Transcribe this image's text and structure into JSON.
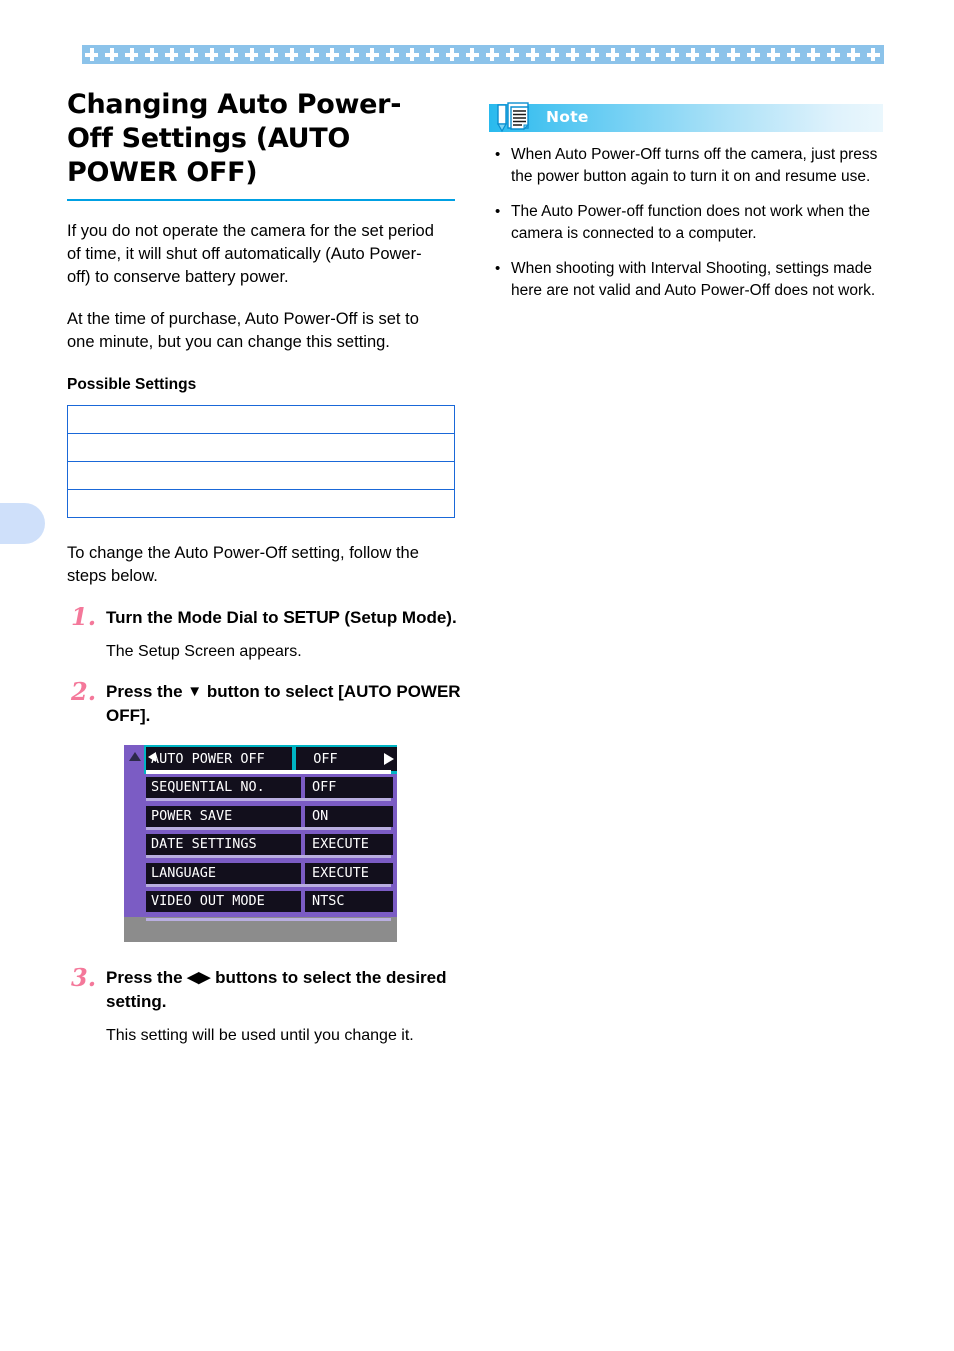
{
  "page": {
    "title": "Changing Auto Power-Off Settings (AUTO POWER OFF)",
    "accent_color": "#00a0e3",
    "step_number_color": "#f4789a",
    "table_border_color": "#1a68d8",
    "band_color": "#8cc3ea"
  },
  "intro": {
    "paragraph1": "If you do not operate the camera for the set period of time, it will shut off automatically (Auto Power-off) to conserve battery power.",
    "paragraph2": "At the time of purchase, Auto Power-Off is set to one minute, but you can change this setting."
  },
  "possible_settings": {
    "heading": "Possible Settings",
    "rows": [
      "",
      "",
      "",
      ""
    ]
  },
  "steps_intro": "To change the Auto Power-Off setting, follow the steps below.",
  "steps": [
    {
      "number": "1.",
      "head_before": "Turn the Mode Dial to ",
      "head_emphasis": "SETUP",
      "head_after": " (Setup Mode).",
      "body": "The Setup Screen appears."
    },
    {
      "number": "2.",
      "head_before": "Press the ",
      "head_glyph": "▼",
      "head_after": " button to select [AUTO POWER OFF].",
      "body": ""
    },
    {
      "number": "3.",
      "head_before": "Press the ",
      "head_glyph": "◀▶",
      "head_after": " buttons to select the desired setting.",
      "body": "This setting will be used until you change it."
    }
  ],
  "lcd": {
    "up_arrow": "▲",
    "left_arrow": "◀",
    "right_arrow": "▶",
    "selected_index": 0,
    "rows": [
      {
        "label": "AUTO POWER OFF",
        "value": "OFF"
      },
      {
        "label": "SEQUENTIAL NO.",
        "value": "OFF"
      },
      {
        "label": "POWER SAVE",
        "value": "ON"
      },
      {
        "label": "DATE SETTINGS",
        "value": "EXECUTE"
      },
      {
        "label": "LANGUAGE",
        "value": "EXECUTE"
      },
      {
        "label": "VIDEO OUT MODE",
        "value": "NTSC"
      }
    ]
  },
  "note": {
    "title": "Note",
    "items": [
      "When Auto Power-Off turns off the camera, just press the power button again to turn it on and resume use.",
      "The Auto Power-off function does not work when the camera is connected to a computer.",
      "When shooting with Interval Shooting, settings made here are not valid and Auto Power-Off does not work."
    ]
  }
}
